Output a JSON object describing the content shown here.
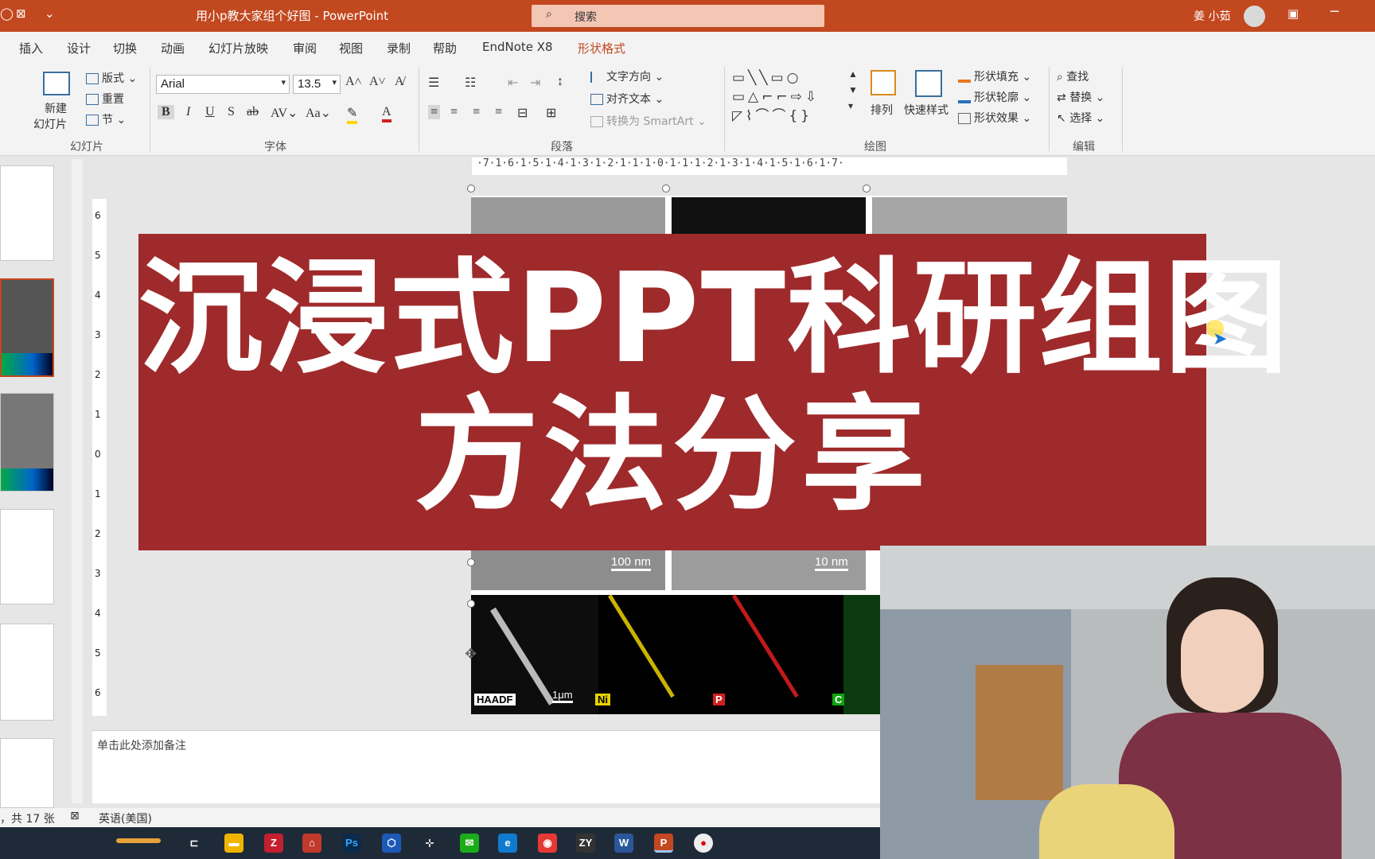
{
  "window": {
    "title": "用小p教大家组个好图 - PowerPoint",
    "search_placeholder": "搜索",
    "user_name": "姜 小茹"
  },
  "tabs": [
    "插入",
    "设计",
    "切换",
    "动画",
    "幻灯片放映",
    "审阅",
    "视图",
    "录制",
    "帮助",
    "EndNote X8",
    "形状格式"
  ],
  "active_tab": "形状格式",
  "ribbon": {
    "slides_group": {
      "new_slide": "新建",
      "new_slide_line2": "幻灯片",
      "layout": "版式",
      "reset": "重置",
      "section": "节",
      "label": "幻灯片"
    },
    "font_group": {
      "font_name": "Arial",
      "font_size": "13.5",
      "label": "字体"
    },
    "paragraph_group": {
      "text_direction": "文字方向",
      "align_text": "对齐文本",
      "convert_smartart": "转换为 SmartArt",
      "label": "段落"
    },
    "drawing_group": {
      "arrange": "排列",
      "quick_styles": "快速样式",
      "shape_fill": "形状填充",
      "shape_outline": "形状轮廓",
      "shape_effects": "形状效果",
      "label": "绘图"
    },
    "editing_group": {
      "find": "查找",
      "replace": "替换",
      "select": "选择",
      "label": "编辑"
    }
  },
  "ruler_h": "·7·1·6·1·5·1·4·1·3·1·2·1·1·1·0·1·1·1·2·1·3·1·4·1·5·1·6·1·7·",
  "ruler_v": [
    "6",
    "5",
    "4",
    "3",
    "2",
    "1",
    "0",
    "1",
    "2",
    "3",
    "4",
    "5",
    "6"
  ],
  "slide": {
    "scale_labels": [
      "100 nm",
      "10 nm",
      "1μm"
    ],
    "element_labels": [
      "HAADF",
      "Ni",
      "P",
      "C"
    ]
  },
  "notes_placeholder": "单击此处添加备注",
  "status": {
    "slide_count": "，共 17 张",
    "language": "英语(美国)"
  },
  "banner": {
    "line1": "沉浸式PPT科研组图",
    "line2": "方法分享"
  },
  "taskbar": {
    "apps": [
      "task-view",
      "file-explorer",
      "zotero",
      "app-red",
      "photoshop",
      "app-blue",
      "app-network",
      "wechat",
      "edge",
      "netease-music",
      "zy",
      "word",
      "powerpoint",
      "recorder"
    ]
  },
  "colors": {
    "accent": "#c2481f",
    "banner": "#9f2a2b",
    "search_box": "#f4c6b4",
    "taskbar": "#1f2a38"
  }
}
